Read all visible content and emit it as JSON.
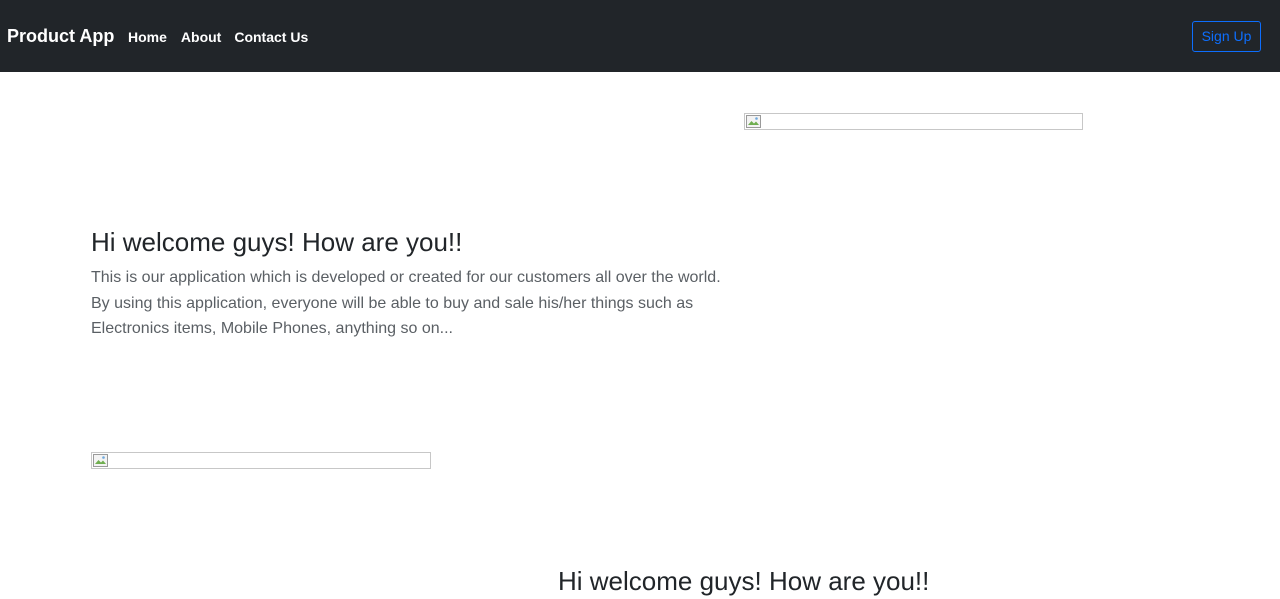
{
  "navbar": {
    "brand": "Product App",
    "links": [
      "Home",
      "About",
      "Contact Us"
    ],
    "signup_label": "Sign Up",
    "signup_color": "#0d6efd",
    "background": "#212529"
  },
  "hero": {
    "headline": "Hi welcome guys! How are you!!",
    "description": "This is our application which is developed or created for our customers all over the world. By using this application, everyone will be able to buy and sale his/her things such as Electronics items, Mobile Phones, anything so on..."
  },
  "section2": {
    "headline": "Hi welcome guys! How are you!!"
  },
  "icons": {
    "broken_image": "broken-image-icon"
  }
}
